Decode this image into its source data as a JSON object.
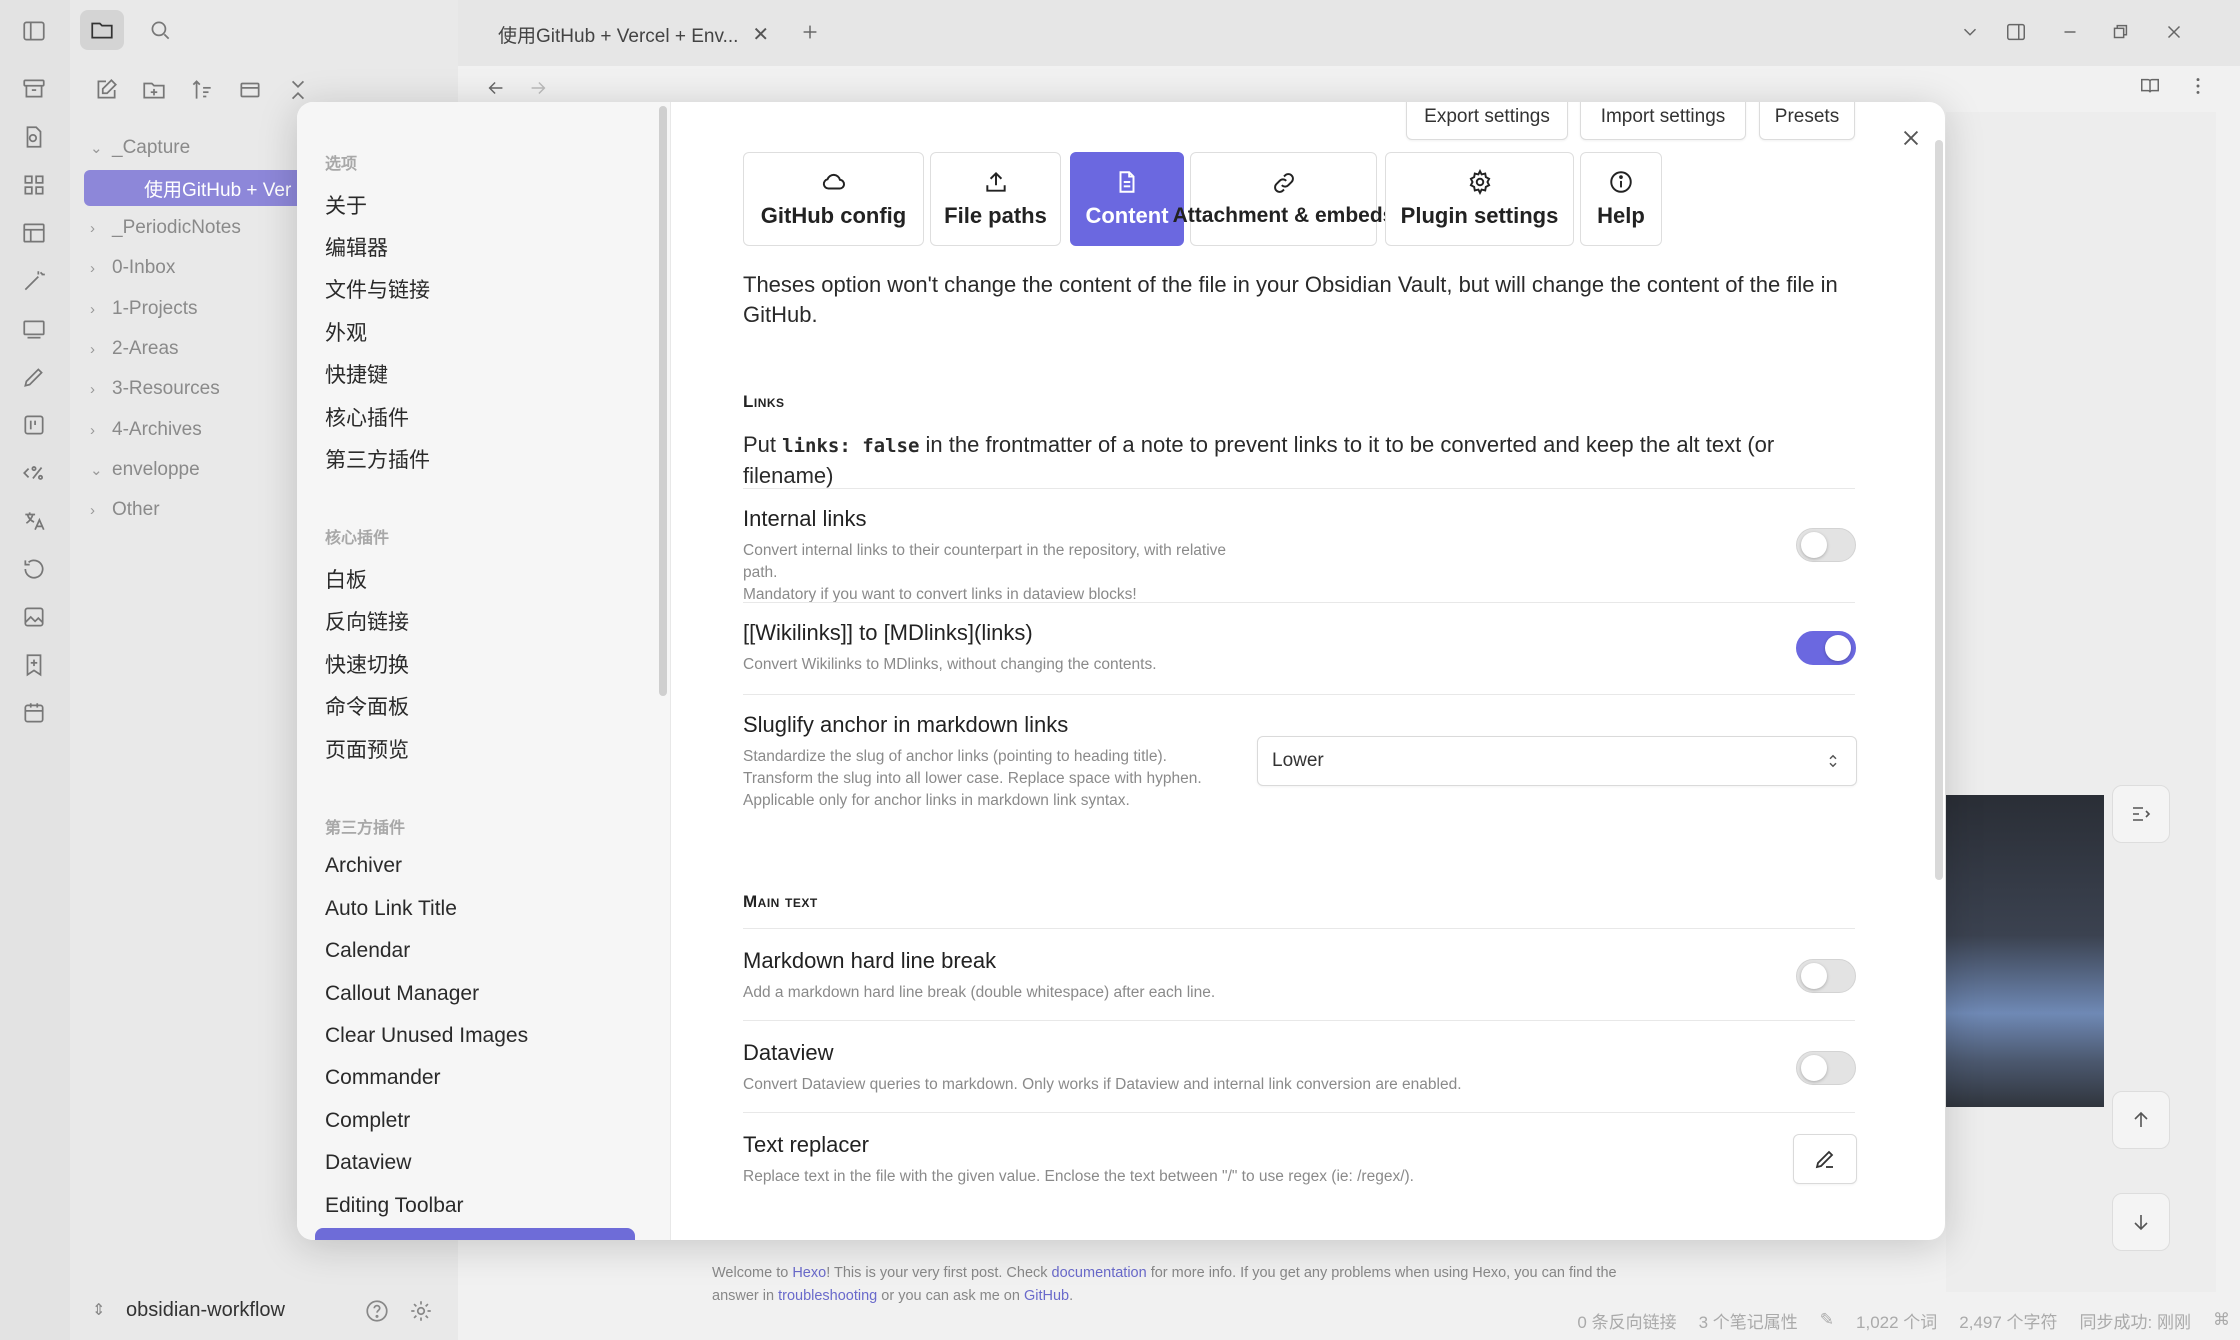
{
  "window": {
    "tab_title": "使用GitHub + Vercel + Env...",
    "nav_back": "←",
    "nav_forward": "→"
  },
  "sidebar": {
    "tree": [
      {
        "label": "_Capture",
        "expanded": true
      },
      {
        "label": "使用GitHub + Ver",
        "active": true
      },
      {
        "label": "_PeriodicNotes"
      },
      {
        "label": "0-Inbox"
      },
      {
        "label": "1-Projects"
      },
      {
        "label": "2-Areas"
      },
      {
        "label": "3-Resources"
      },
      {
        "label": "4-Archives"
      },
      {
        "label": "enveloppe",
        "expanded": true
      },
      {
        "label": "Other"
      }
    ],
    "vault_name": "obsidian-workflow"
  },
  "note_footer": {
    "part1": "Welcome to ",
    "link1": "Hexo",
    "part2": "! This is your very first post. Check ",
    "link2": "documentation",
    "part3": " for more info. If you get any problems when using Hexo, you can find the answer in ",
    "link3": "troubleshooting",
    "part4": " or you can ask me on ",
    "link4": "GitHub",
    "part5": "."
  },
  "status_bar": {
    "backlinks": "0 条反向链接",
    "properties": "3 个笔记属性",
    "words": "1,022 个词",
    "chars": "2,497 个字符",
    "sync": "同步成功: 刚刚"
  },
  "settings_nav": {
    "section_options": "选项",
    "options": [
      "关于",
      "编辑器",
      "文件与链接",
      "外观",
      "快捷键",
      "核心插件",
      "第三方插件"
    ],
    "section_core": "核心插件",
    "core": [
      "白板",
      "反向链接",
      "快速切换",
      "命令面板",
      "页面预览"
    ],
    "section_third": "第三方插件",
    "third": [
      "Archiver",
      "Auto Link Title",
      "Calendar",
      "Callout Manager",
      "Clear Unused Images",
      "Commander",
      "Completr",
      "Dataview",
      "Editing Toolbar"
    ]
  },
  "top_buttons": {
    "export": "Export settings",
    "import": "Import settings",
    "presets": "Presets"
  },
  "plugin_tabs": [
    {
      "label": "GitHub config",
      "icon": "cloud-icon"
    },
    {
      "label": "File paths",
      "icon": "upload-icon"
    },
    {
      "label": "Content",
      "icon": "file-text-icon",
      "active": true
    },
    {
      "label": "Attachment & embeds",
      "icon": "link-icon"
    },
    {
      "label": "Plugin settings",
      "icon": "gear-icon"
    },
    {
      "label": "Help",
      "icon": "info-icon"
    }
  ],
  "content": {
    "intro": "Theses option won't change the content of the file in your Obsidian Vault, but will change the content of the file in GitHub.",
    "links_heading": "Links",
    "links_desc_pre": "Put ",
    "links_desc_code": "links: false",
    "links_desc_post": " in the frontmatter of a note to prevent links to it to be converted and keep the alt text (or filename)",
    "internal_links": {
      "name": "Internal links",
      "desc1": "Convert internal links to their counterpart in the repository, with relative path.",
      "desc2": "Mandatory if you want to convert links in dataview blocks!",
      "enabled": false
    },
    "wikilinks": {
      "name": "[[Wikilinks]] to [MDlinks](links)",
      "desc": "Convert Wikilinks to MDlinks, without changing the contents.",
      "enabled": true
    },
    "sluglify": {
      "name": "Sluglify anchor in markdown links",
      "desc1": "Standardize the slug of anchor links (pointing to heading title).",
      "desc2": "Transform the slug into all lower case. Replace space with hyphen.",
      "desc3": "Applicable only for anchor links in markdown link syntax.",
      "value": "Lower"
    },
    "main_heading": "Main text",
    "hard_break": {
      "name": "Markdown hard line break",
      "desc": "Add a markdown hard line break (double whitespace) after each line.",
      "enabled": false
    },
    "dataview": {
      "name": "Dataview",
      "desc": "Convert Dataview queries to markdown. Only works if Dataview and internal link conversion are enabled.",
      "enabled": false
    },
    "text_replacer": {
      "name": "Text replacer",
      "desc": "Replace text in the file with the given value. Enclose the text between \"/\" to use regex (ie: /regex/)."
    }
  },
  "colors": {
    "accent": "#6b68e0",
    "sidebar_active": "#8d87d9"
  }
}
